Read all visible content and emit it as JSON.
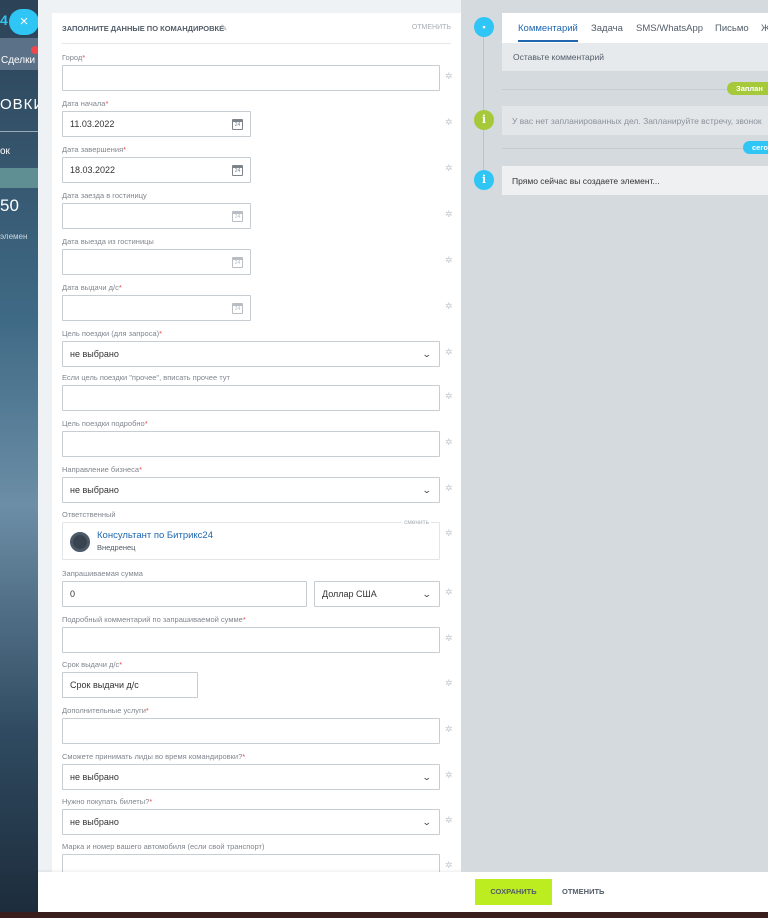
{
  "background": {
    "logo_fragment": "4",
    "deals_label": "Сделки",
    "heading_fragment": "ОВКИ",
    "sub_fragment": "ок",
    "number_fragment": "50",
    "elements_fragment": "элемен",
    "close_label": "×"
  },
  "form": {
    "title": "ЗАПОЛНИТЕ ДАННЫЕ ПО КОМАНДИРОВКЕ",
    "header_cancel": "ОТМЕНИТЬ",
    "fields": [
      {
        "label": "Город",
        "required": true,
        "type": "text",
        "value": ""
      },
      {
        "label": "Дата начала",
        "required": true,
        "type": "date",
        "value": "11.03.2022"
      },
      {
        "label": "Дата завершения",
        "required": true,
        "type": "date",
        "value": "18.03.2022"
      },
      {
        "label": "Дата заезда в гостиницу",
        "required": false,
        "type": "date",
        "value": ""
      },
      {
        "label": "Дата выезда из гостиницы",
        "required": false,
        "type": "date",
        "value": ""
      },
      {
        "label": "Дата выдачи д/с",
        "required": true,
        "type": "date",
        "value": ""
      },
      {
        "label": "Цель поездки (для запроса)",
        "required": true,
        "type": "select",
        "value": "не выбрано"
      },
      {
        "label": "Если цель поездки \"прочее\", вписать прочее тут",
        "required": false,
        "type": "text",
        "value": ""
      },
      {
        "label": "Цель поездки подробно",
        "required": true,
        "type": "text",
        "value": ""
      },
      {
        "label": "Направление бизнеса",
        "required": true,
        "type": "select",
        "value": "не выбрано"
      },
      {
        "label": "Ответственный",
        "required": false,
        "type": "user",
        "value": ""
      },
      {
        "label": "Запрашиваемая сумма",
        "required": false,
        "type": "money",
        "value": "0"
      },
      {
        "label": "Подробный комментарий по запрашиваемой сумме",
        "required": true,
        "type": "text",
        "value": ""
      },
      {
        "label": "Срок выдачи д/с",
        "required": true,
        "type": "text",
        "value": ""
      },
      {
        "label": "Дополнительные услуги",
        "required": true,
        "type": "text",
        "value": ""
      },
      {
        "label": "Сможете принимать лиды во время командировки?",
        "required": true,
        "type": "select",
        "value": "не выбрано"
      },
      {
        "label": "Нужно покупать билеты?",
        "required": true,
        "type": "select",
        "value": "не выбрано"
      },
      {
        "label": "Марка и номер вашего автомобиля (если свой транспорт)",
        "required": false,
        "type": "text",
        "value": ""
      }
    ],
    "responsible": {
      "name": "Консультант по Битрикс24",
      "role": "Внедренец",
      "change_label": "сменить"
    },
    "currency": "Доллар США",
    "term_placeholder": "Срок выдачи д/с",
    "required_mark": "*",
    "calendar_icon_text": "24",
    "chevron_glyph": "⌄",
    "gear_glyph": "✲"
  },
  "footer": {
    "save_label": "СОХРАНИТЬ",
    "cancel_label": "ОТМЕНИТЬ"
  },
  "timeline": {
    "tabs": [
      "Комментарий",
      "Задача",
      "SMS/WhatsApp",
      "Письмо",
      "Ж"
    ],
    "active_tab": "Комментарий",
    "comment_placeholder": "Оставьте комментарий",
    "planned_pill": "Заплан",
    "planned_text": "У вас нет запланированных дел. Запланируйте встречу, звонок",
    "today_pill": "сего",
    "creating_text": "Прямо сейчас вы создаете элемент...",
    "info_glyph": "i"
  },
  "colors": {
    "accent_blue": "#2fc6f6",
    "link_blue": "#2067b0",
    "save_green": "#bbed21",
    "planned_green": "#a5c939",
    "required_red": "#f0484a"
  },
  "icons": [
    "close-icon",
    "pencil-icon",
    "calendar-icon",
    "chevron-down-icon",
    "gear-icon",
    "comment-icon",
    "info-icon",
    "avatar"
  ]
}
